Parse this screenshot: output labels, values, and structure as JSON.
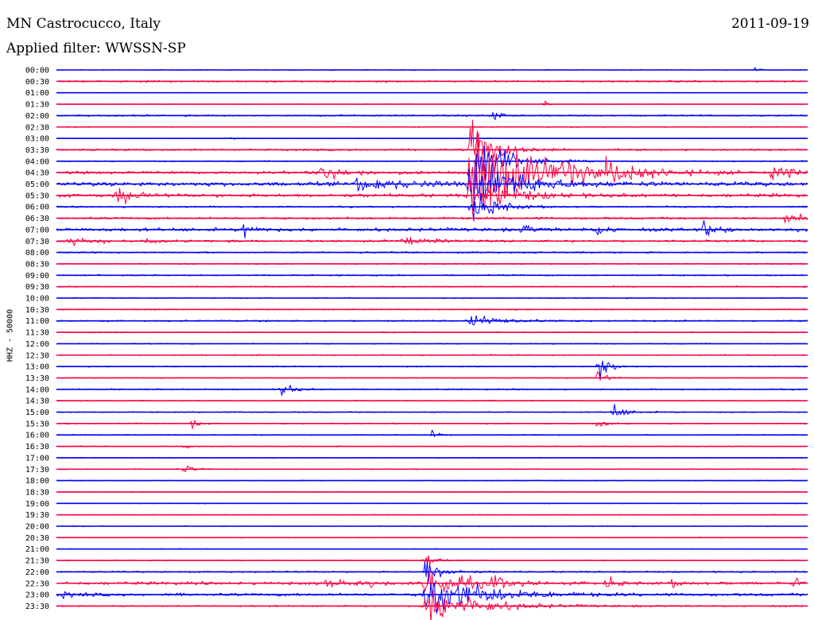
{
  "header": {
    "station": "MN Castrocucco, Italy",
    "date": "2011-09-19",
    "filter": "Applied filter: WWSSN-SP"
  },
  "chart_data": {
    "type": "line",
    "title": "MN Castrocucco, Italy",
    "ylabel": "HHZ - 50000",
    "colors": [
      "#0000ff",
      "#ff0040"
    ],
    "rows": [
      {
        "label": "00:00",
        "noise": 0.4,
        "events": [
          {
            "t": 0.93,
            "amp": 3,
            "dur": 0.005
          }
        ]
      },
      {
        "label": "00:30",
        "noise": 0.9,
        "events": []
      },
      {
        "label": "01:00",
        "noise": 0.3,
        "events": []
      },
      {
        "label": "01:30",
        "noise": 0.3,
        "events": [
          {
            "t": 0.65,
            "amp": 5,
            "dur": 0.004
          }
        ]
      },
      {
        "label": "02:00",
        "noise": 0.8,
        "events": [
          {
            "t": 0.58,
            "amp": 10,
            "dur": 0.01
          }
        ]
      },
      {
        "label": "02:30",
        "noise": 0.5,
        "events": []
      },
      {
        "label": "03:00",
        "noise": 0.3,
        "events": [
          {
            "t": 0.23,
            "amp": 3,
            "dur": 0.005
          }
        ]
      },
      {
        "label": "03:30",
        "noise": 1.0,
        "events": [
          {
            "t": 0.55,
            "amp": 28,
            "dur": 0.03
          }
        ]
      },
      {
        "label": "04:00",
        "noise": 0.6,
        "events": [
          {
            "t": 0.56,
            "amp": 30,
            "dur": 0.035
          }
        ]
      },
      {
        "label": "04:30",
        "noise": 1.5,
        "events": [
          {
            "t": 0.35,
            "amp": 9,
            "dur": 0.03
          },
          {
            "t": 0.55,
            "amp": 55,
            "dur": 0.07
          },
          {
            "t": 0.68,
            "amp": 9,
            "dur": 0.015
          },
          {
            "t": 0.73,
            "amp": 9,
            "dur": 0.05
          },
          {
            "t": 0.95,
            "amp": 5,
            "dur": 0.05
          }
        ]
      },
      {
        "label": "05:00",
        "noise": 2.2,
        "events": [
          {
            "t": 0.4,
            "amp": 7,
            "dur": 0.06
          },
          {
            "t": 0.55,
            "amp": 35,
            "dur": 0.05
          }
        ]
      },
      {
        "label": "05:30",
        "noise": 1.8,
        "events": [
          {
            "t": 0.08,
            "amp": 13,
            "dur": 0.015
          },
          {
            "t": 0.55,
            "amp": 25,
            "dur": 0.04
          }
        ]
      },
      {
        "label": "06:00",
        "noise": 0.8,
        "events": [
          {
            "t": 0.55,
            "amp": 18,
            "dur": 0.03
          }
        ]
      },
      {
        "label": "06:30",
        "noise": 1.2,
        "events": [
          {
            "t": 0.97,
            "amp": 5,
            "dur": 0.04
          }
        ]
      },
      {
        "label": "07:00",
        "noise": 1.8,
        "events": [
          {
            "t": 0.25,
            "amp": 11,
            "dur": 0.01
          },
          {
            "t": 0.62,
            "amp": 6,
            "dur": 0.01
          },
          {
            "t": 0.72,
            "amp": 8,
            "dur": 0.01
          },
          {
            "t": 0.86,
            "amp": 7,
            "dur": 0.02
          }
        ]
      },
      {
        "label": "07:30",
        "noise": 1.2,
        "events": [
          {
            "t": 0.02,
            "amp": 9,
            "dur": 0.02
          },
          {
            "t": 0.12,
            "amp": 4,
            "dur": 0.01
          },
          {
            "t": 0.46,
            "amp": 4,
            "dur": 0.03
          }
        ]
      },
      {
        "label": "08:00",
        "noise": 0.8,
        "events": []
      },
      {
        "label": "08:30",
        "noise": 0.6,
        "events": []
      },
      {
        "label": "09:00",
        "noise": 0.7,
        "events": []
      },
      {
        "label": "09:30",
        "noise": 0.6,
        "events": []
      },
      {
        "label": "10:00",
        "noise": 0.5,
        "events": []
      },
      {
        "label": "10:30",
        "noise": 0.6,
        "events": []
      },
      {
        "label": "11:00",
        "noise": 0.8,
        "events": [
          {
            "t": 0.55,
            "amp": 7,
            "dur": 0.04
          }
        ]
      },
      {
        "label": "11:30",
        "noise": 0.5,
        "events": []
      },
      {
        "label": "12:00",
        "noise": 0.5,
        "events": []
      },
      {
        "label": "12:30",
        "noise": 0.6,
        "events": []
      },
      {
        "label": "13:00",
        "noise": 0.6,
        "events": [
          {
            "t": 0.72,
            "amp": 20,
            "dur": 0.012
          }
        ]
      },
      {
        "label": "13:30",
        "noise": 0.5,
        "events": [
          {
            "t": 0.72,
            "amp": 8,
            "dur": 0.01
          }
        ]
      },
      {
        "label": "14:00",
        "noise": 0.7,
        "events": [
          {
            "t": 0.3,
            "amp": 9,
            "dur": 0.012
          }
        ]
      },
      {
        "label": "14:30",
        "noise": 0.5,
        "events": []
      },
      {
        "label": "15:00",
        "noise": 0.6,
        "events": [
          {
            "t": 0.74,
            "amp": 9,
            "dur": 0.015
          }
        ]
      },
      {
        "label": "15:30",
        "noise": 0.6,
        "events": [
          {
            "t": 0.18,
            "amp": 4,
            "dur": 0.01
          },
          {
            "t": 0.72,
            "amp": 5,
            "dur": 0.01
          }
        ]
      },
      {
        "label": "16:00",
        "noise": 0.5,
        "events": [
          {
            "t": 0.5,
            "amp": 4,
            "dur": 0.008
          }
        ]
      },
      {
        "label": "16:30",
        "noise": 0.5,
        "events": [
          {
            "t": 0.17,
            "amp": 3,
            "dur": 0.008
          }
        ]
      },
      {
        "label": "17:00",
        "noise": 0.4,
        "events": []
      },
      {
        "label": "17:30",
        "noise": 0.5,
        "events": [
          {
            "t": 0.17,
            "amp": 7,
            "dur": 0.008
          }
        ]
      },
      {
        "label": "18:00",
        "noise": 0.4,
        "events": []
      },
      {
        "label": "18:30",
        "noise": 0.4,
        "events": []
      },
      {
        "label": "19:00",
        "noise": 0.4,
        "events": []
      },
      {
        "label": "19:30",
        "noise": 0.4,
        "events": []
      },
      {
        "label": "20:00",
        "noise": 0.4,
        "events": []
      },
      {
        "label": "20:30",
        "noise": 0.4,
        "events": []
      },
      {
        "label": "21:00",
        "noise": 0.4,
        "events": []
      },
      {
        "label": "21:30",
        "noise": 0.5,
        "events": [
          {
            "t": 0.49,
            "amp": 10,
            "dur": 0.01
          }
        ]
      },
      {
        "label": "22:00",
        "noise": 0.8,
        "events": [
          {
            "t": 0.49,
            "amp": 16,
            "dur": 0.02
          }
        ]
      },
      {
        "label": "22:30",
        "noise": 1.6,
        "events": [
          {
            "t": 0.36,
            "amp": 8,
            "dur": 0.01
          },
          {
            "t": 0.4,
            "amp": 5,
            "dur": 0.01
          },
          {
            "t": 0.42,
            "amp": 5,
            "dur": 0.01
          },
          {
            "t": 0.49,
            "amp": 20,
            "dur": 0.04
          },
          {
            "t": 0.58,
            "amp": 8,
            "dur": 0.015
          },
          {
            "t": 0.73,
            "amp": 7,
            "dur": 0.012
          },
          {
            "t": 0.82,
            "amp": 4,
            "dur": 0.01
          },
          {
            "t": 0.98,
            "amp": 5,
            "dur": 0.01
          }
        ]
      },
      {
        "label": "23:00",
        "noise": 1.5,
        "events": [
          {
            "t": 0.01,
            "amp": 4,
            "dur": 0.015
          },
          {
            "t": 0.49,
            "amp": 28,
            "dur": 0.06
          }
        ]
      },
      {
        "label": "23:30",
        "noise": 0.8,
        "events": [
          {
            "t": 0.49,
            "amp": 22,
            "dur": 0.06
          }
        ]
      }
    ]
  }
}
